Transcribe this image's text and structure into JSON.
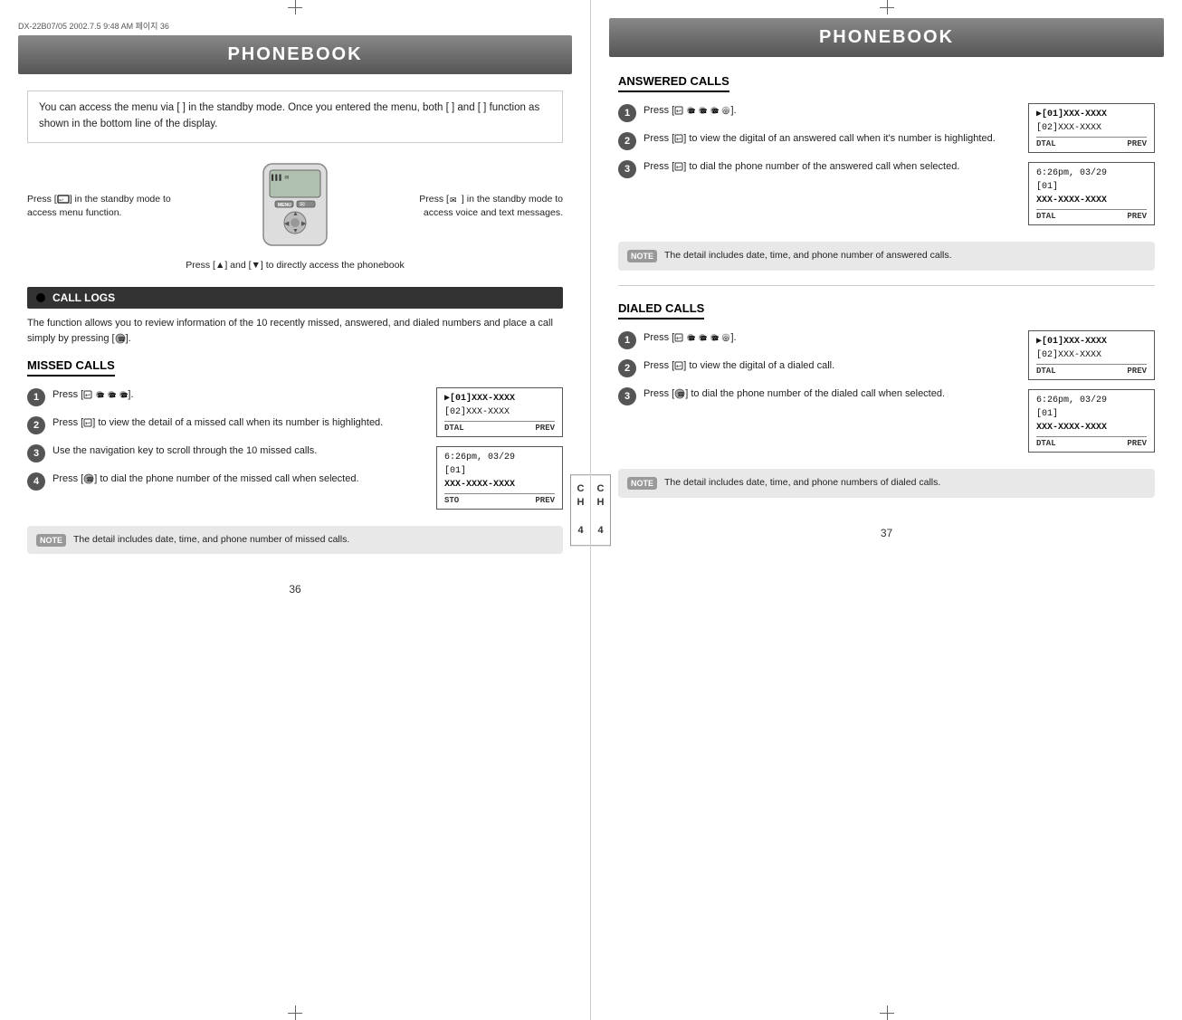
{
  "left_page": {
    "file_info": "DX-22B07/05  2002.7.5 9:48 AM  페이지 36",
    "header": "PHONEBOOK",
    "intro": {
      "text": "You can access the menu via [  ] in the standby mode. Once you entered the menu, both [  ] and [  ] function as shown in the bottom line of the display."
    },
    "label_left": {
      "line1": "Press [  ] in",
      "line2": "the standby",
      "line3": "mode to access",
      "line4": "menu function."
    },
    "label_right": {
      "line1": "Press [  ] in the",
      "line2": "standby mode to",
      "line3": "access voice and",
      "line4": "text messages."
    },
    "label_below": "Press [▲] and [▼] to directly access the phonebook",
    "call_logs_heading": "CALL LOGS",
    "call_logs_text": "The function allows you to review information of the 10 recently missed, answered, and dialed numbers and place a call simply by pressing [  ].",
    "missed_calls": {
      "heading": "MISSED CALLS",
      "steps": [
        {
          "num": "1",
          "text": "Press [  ☎  ☎  ☎ ]."
        },
        {
          "num": "2",
          "text": "Press [  ] to view the detail of a missed call when its number is highlighted."
        },
        {
          "num": "3",
          "text": "Use the navigation key to scroll through the 10 missed calls."
        },
        {
          "num": "4",
          "text": "Press [  ] to dial the phone number of the missed call when selected."
        }
      ],
      "screen1": {
        "line1": "▶[01]XXX-XXXX",
        "line2": "[02]XXX-XXXX",
        "btn_left": "DTAL",
        "btn_right": "PREV"
      },
      "screen2": {
        "line1": "6:26pm, 03/29",
        "line2": "[01]",
        "line3": "  XXX-XXXX-XXXX",
        "btn_left": "STO",
        "btn_right": "PREV"
      },
      "note_text": "The detail includes date, time, and phone number of missed calls."
    },
    "page_number": "36",
    "chapter": {
      "line1": "C",
      "line2": "H",
      "line3": "",
      "line4": "4"
    }
  },
  "right_page": {
    "header": "PHONEBOOK",
    "answered_calls": {
      "heading": "ANSWERED CALLS",
      "steps": [
        {
          "num": "1",
          "text": "Press [  ☎  ☎  ☎  ]."
        },
        {
          "num": "2",
          "text": "Press [  ] to view the digital of an answered call when it's number is highlighted."
        },
        {
          "num": "3",
          "text": "Press [  ] to dial the phone number of the answered call when selected."
        }
      ],
      "screen1": {
        "line1": "▶[01]XXX-XXXX",
        "line2": "[02]XXX-XXXX",
        "btn_left": "DTAL",
        "btn_right": "PREV"
      },
      "screen2": {
        "line1": "6:26pm, 03/29",
        "line2": "[01]",
        "line3": "  XXX-XXXX-XXXX",
        "btn_left": "DTAL",
        "btn_right": "PREV"
      },
      "note_text": "The detail includes date, time, and phone number of answered calls."
    },
    "dialed_calls": {
      "heading": "DIALED CALLS",
      "steps": [
        {
          "num": "1",
          "text": "Press [  ☎  ☎  ☎  ]."
        },
        {
          "num": "2",
          "text": "Press [  ] to view the digital of a dialed call."
        },
        {
          "num": "3",
          "text": "Press [  ] to dial the phone number of the dialed call when selected."
        }
      ],
      "screen1": {
        "line1": "▶[01]XXX-XXXX",
        "line2": "[02]XXX-XXXX",
        "btn_left": "DTAL",
        "btn_right": "PREV"
      },
      "screen2": {
        "line1": "6:26pm, 03/29",
        "line2": "[01]",
        "line3": "  XXX-XXXX-XXXX",
        "btn_left": "DTAL",
        "btn_right": "PREV"
      },
      "note_text": "The detail includes date, time, and phone numbers of dialed calls."
    },
    "page_number": "37",
    "chapter": {
      "line1": "C",
      "line2": "H",
      "line3": "",
      "line4": "4"
    }
  }
}
